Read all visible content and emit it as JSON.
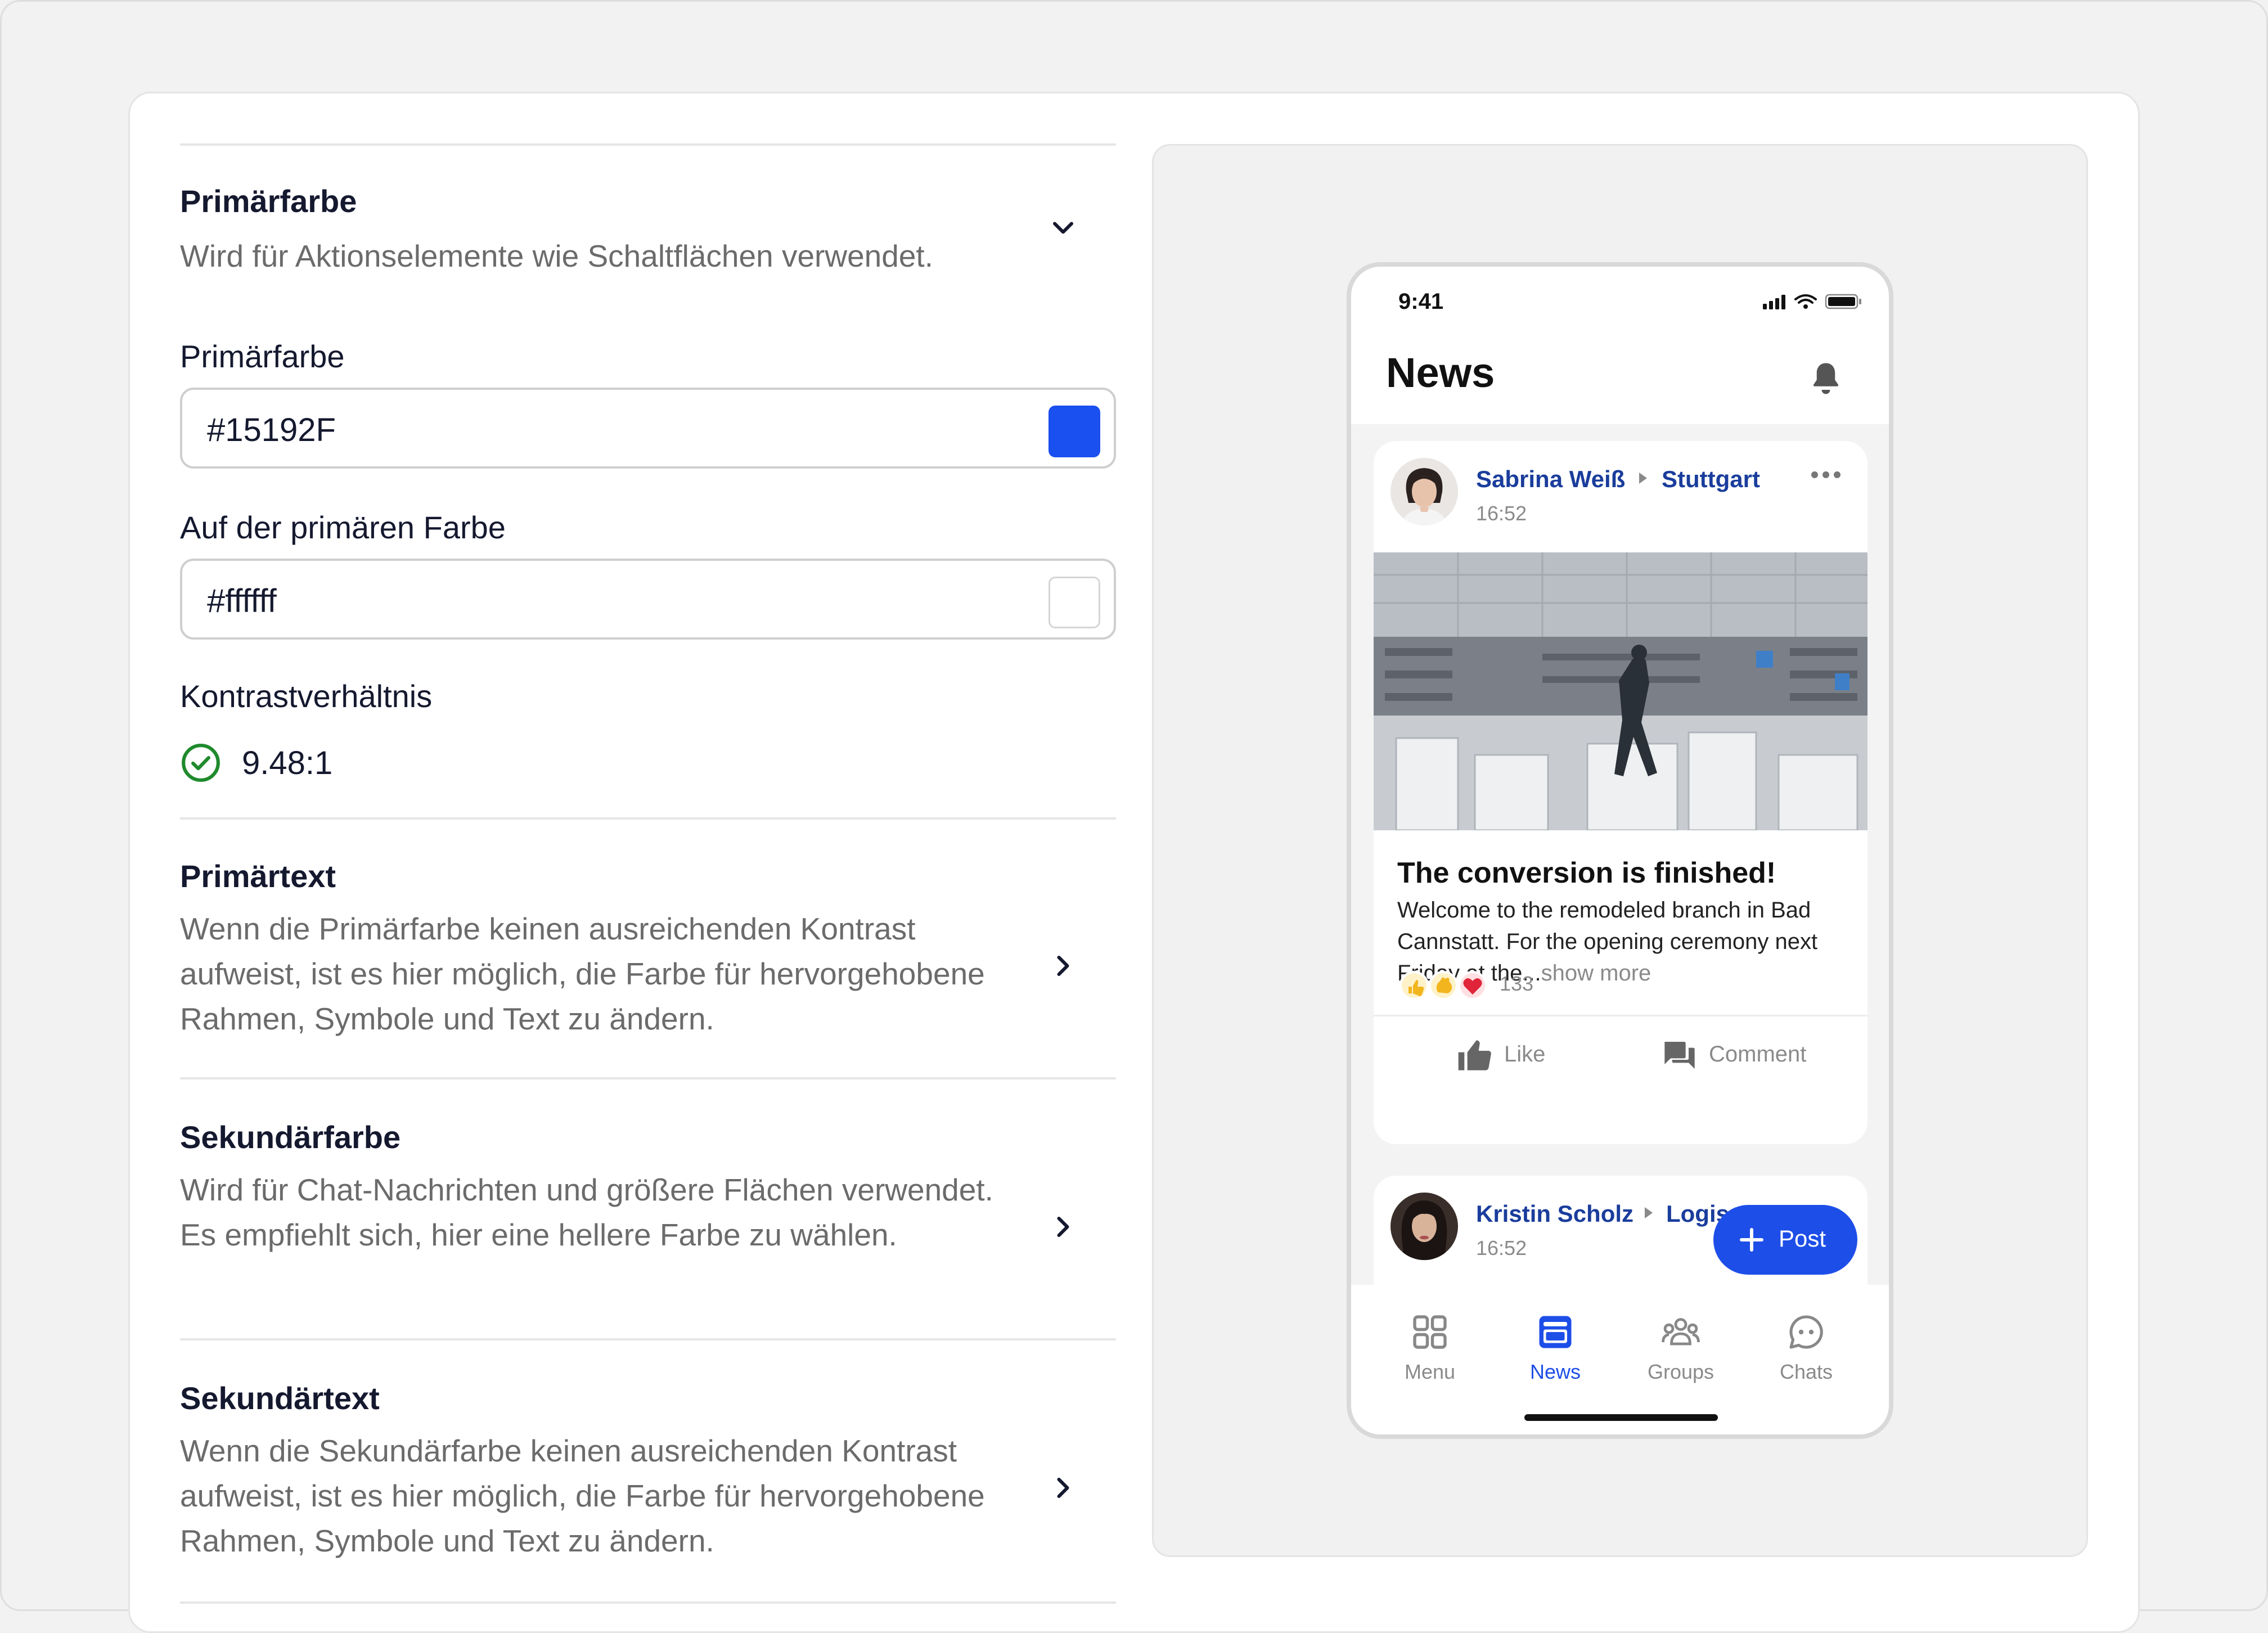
{
  "settings": {
    "primary_section": {
      "title": "Primärfarbe",
      "description": "Wird für Aktionselemente wie Schaltflächen verwendet."
    },
    "primary_color": {
      "label": "Primärfarbe",
      "value": "#15192F",
      "swatch": "#1a4ff0"
    },
    "on_primary_color": {
      "label": "Auf der primären Farbe",
      "value": "#ffffff",
      "swatch": "#ffffff"
    },
    "contrast": {
      "label": "Kontrastverhältnis",
      "value": "9.48:1",
      "status_color": "#1f8a2c"
    },
    "primary_text": {
      "title": "Primärtext",
      "description": "Wenn die Primärfarbe keinen ausreichenden Kontrast aufweist, ist es hier möglich, die Farbe für hervorgehobene Rahmen, Symbole und Text zu ändern."
    },
    "secondary_color": {
      "title": "Sekundärfarbe",
      "description": "Wird für Chat-Nachrichten und größere Flächen verwendet. Es empfiehlt sich, hier eine hellere Farbe zu wählen."
    },
    "secondary_text": {
      "title": "Sekundärtext",
      "description": "Wenn die Sekundärfarbe keinen ausreichenden Kontrast aufweist, ist es hier möglich, die Farbe für hervorgehobene Rahmen, Symbole und Text zu ändern."
    }
  },
  "phone": {
    "status_time": "9:41",
    "title": "News",
    "posts": [
      {
        "author": "Sabrina Weiß",
        "location": "Stuttgart",
        "time": "16:52",
        "title": "The conversion is finished!",
        "body": "Welcome to the remodeled branch in Bad Cannstatt. For the opening ceremony next Friday at the...",
        "show_more": "show more",
        "reaction_count": "133",
        "like_label": "Like",
        "comment_label": "Comment"
      },
      {
        "author": "Kristin Scholz",
        "location": "Logis",
        "time": "16:52"
      }
    ],
    "fab_label": "Post",
    "tabs": [
      {
        "label": "Menu",
        "icon": "grid-icon"
      },
      {
        "label": "News",
        "icon": "news-icon"
      },
      {
        "label": "Groups",
        "icon": "groups-icon"
      },
      {
        "label": "Chats",
        "icon": "chat-icon"
      }
    ],
    "accent": "#1d4ee8",
    "author_color": "#1a3d9c"
  }
}
